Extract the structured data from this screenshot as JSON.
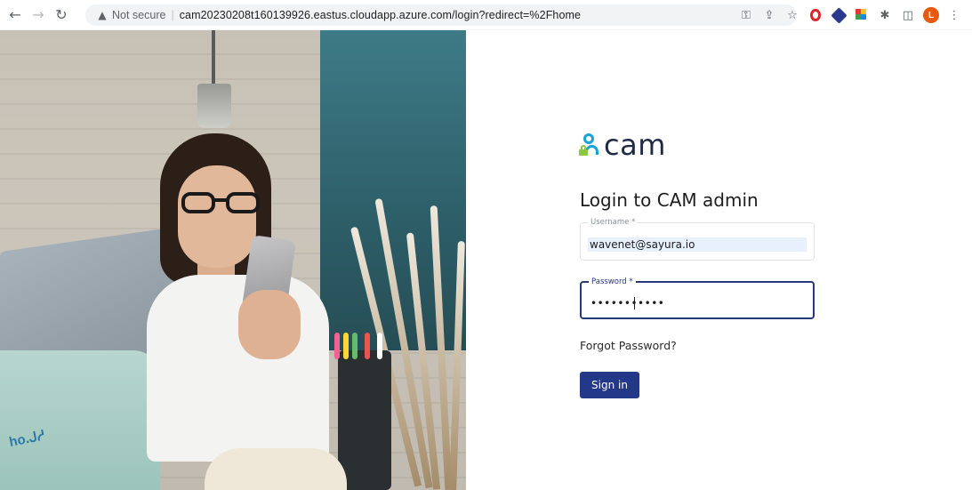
{
  "browser": {
    "security_label": "Not secure",
    "separator": "|",
    "url": "cam20230208t160139926.eastus.cloudapp.azure.com/login?redirect=%2Fhome",
    "profile_initial": "L",
    "icons": [
      "back-icon",
      "forward-icon",
      "reload-icon",
      "warning-icon",
      "key-icon",
      "share-icon",
      "star-icon",
      "opera-icon",
      "extension-icon",
      "extension-color-icon",
      "puzzle-icon",
      "sidepanel-icon",
      "profile-avatar",
      "menu-icon"
    ]
  },
  "hero": {
    "watermark": "ho.ᒍᓱ"
  },
  "brand": {
    "name": "cam",
    "accent_color": "#1aa3d6",
    "lock_color": "#8dc63f"
  },
  "login": {
    "title": "Login to CAM admin",
    "username_label": "Username *",
    "username_value": "wavenet@sayura.io",
    "password_label": "Password *",
    "password_value": "•••••••••••",
    "forgot_label": "Forgot Password?",
    "signin_label": "Sign in",
    "primary_color": "#24388a"
  }
}
